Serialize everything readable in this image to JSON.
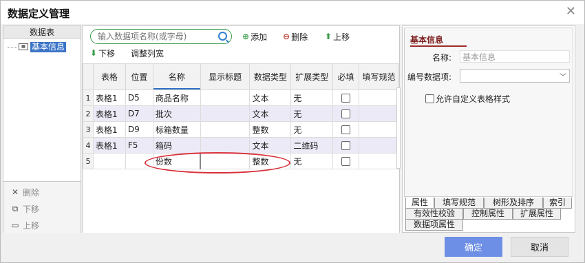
{
  "dialog": {
    "title": "数据定义管理",
    "close_glyph": "✕"
  },
  "left": {
    "header": "数据表",
    "tree_item": "基本信息",
    "actions": [
      {
        "label": "删除",
        "icon": "✕"
      },
      {
        "label": "下移",
        "icon": "⧉"
      },
      {
        "label": "上移",
        "icon": "▭"
      }
    ]
  },
  "toolbar": {
    "search_placeholder": "输入数据项名称(或字母)",
    "add_label": "添加",
    "delete_label": "删除",
    "up_label": "上移",
    "down_label": "下移",
    "adjust_label": "调整列宽"
  },
  "grid": {
    "headers": [
      "",
      "表格",
      "位置",
      "名称",
      "显示标题",
      "数据类型",
      "扩展类型",
      "必填",
      "填写规范"
    ],
    "rows": [
      {
        "n": "1",
        "table": "表格1",
        "pos": "D5",
        "name": "商品名称",
        "title": "",
        "dtype": "文本",
        "ext": "无"
      },
      {
        "n": "2",
        "table": "表格1",
        "pos": "D7",
        "name": "批次",
        "title": "",
        "dtype": "文本",
        "ext": "无"
      },
      {
        "n": "3",
        "table": "表格1",
        "pos": "D9",
        "name": "标箱数量",
        "title": "",
        "dtype": "整数",
        "ext": "无"
      },
      {
        "n": "4",
        "table": "表格1",
        "pos": "F5",
        "name": "箱码",
        "title": "",
        "dtype": "文本",
        "ext": "二维码"
      },
      {
        "n": "5",
        "table": "",
        "pos": "",
        "name": "份数",
        "title": "",
        "dtype": "整数",
        "ext": "无"
      }
    ]
  },
  "right": {
    "section_title": "基本信息",
    "name_label": "名称:",
    "name_value": "基本信息",
    "code_label": "编号数据项:",
    "code_value": "",
    "custom_style_label": "允许自定义表格样式",
    "tabs": [
      "属性",
      "填写规范",
      "树形及排序",
      "索引",
      "有效性校验",
      "控制属性",
      "扩展属性",
      "数据项属性"
    ]
  },
  "buttons": {
    "ok": "确定",
    "cancel": "取消"
  },
  "colors": {
    "ok": "#6d8fe5",
    "selected": "#3b74c7",
    "highlight": "#d9303a",
    "section": "#7a1a1a"
  }
}
